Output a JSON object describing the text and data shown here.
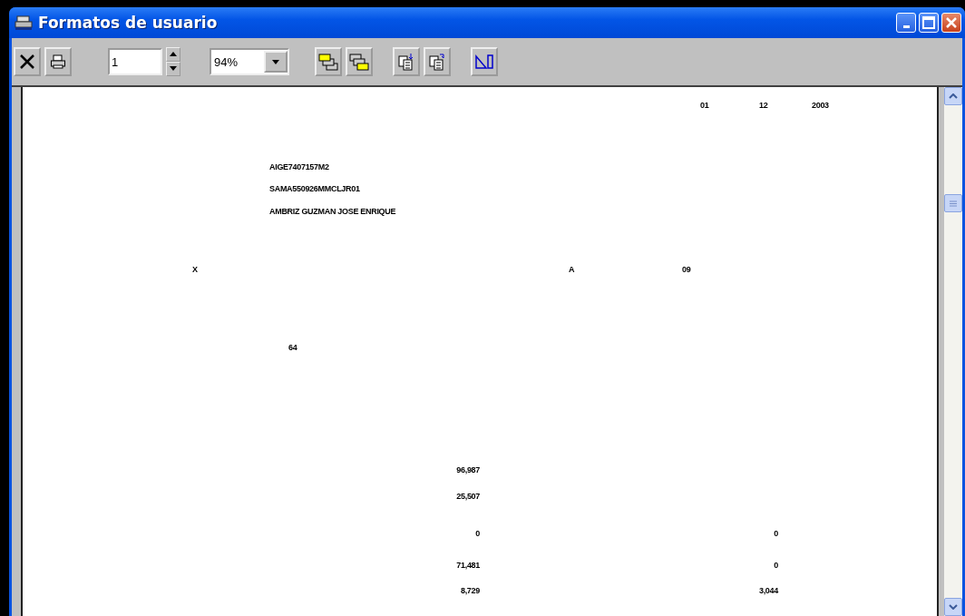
{
  "window": {
    "title": "Formatos de usuario"
  },
  "toolbar": {
    "page": "1",
    "zoom": "94%"
  },
  "report": {
    "fields": [
      {
        "text": "01"
      },
      {
        "text": "12"
      },
      {
        "text": "2003"
      },
      {
        "text": "AIGE7407157M2"
      },
      {
        "text": "SAMA550926MMCLJR01"
      },
      {
        "text": "AMBRIZ GUZMAN JOSE ENRIQUE"
      },
      {
        "text": "X"
      },
      {
        "text": "A"
      },
      {
        "text": "09"
      },
      {
        "text": "64"
      },
      {
        "text": "96,987"
      },
      {
        "text": "25,507"
      },
      {
        "text": "0"
      },
      {
        "text": "0"
      },
      {
        "text": "71,481"
      },
      {
        "text": "0"
      },
      {
        "text": "8,729"
      },
      {
        "text": "3,044"
      }
    ]
  }
}
